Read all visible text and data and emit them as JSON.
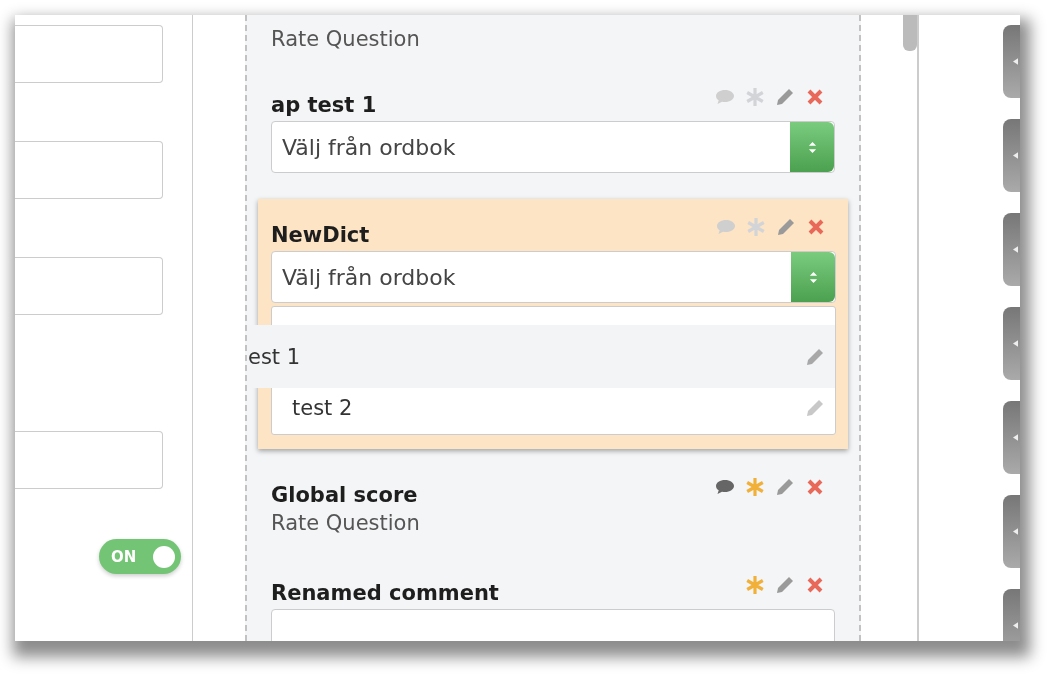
{
  "left_panel": {
    "toggle": {
      "label": "ON",
      "on": true
    }
  },
  "questions": [
    {
      "kind": "rate",
      "subtitle": "Rate Question"
    },
    {
      "kind": "dictionary",
      "title": "ap test 1",
      "comment_icon": true,
      "commented": false,
      "starred": false,
      "highlighted": false,
      "select": {
        "placeholder": "Välj från ordbok"
      }
    },
    {
      "kind": "dictionary",
      "title": "NewDict",
      "comment_icon": true,
      "commented": false,
      "starred": false,
      "highlighted": true,
      "select": {
        "placeholder": "Välj från ordbok"
      },
      "options": [
        {
          "label": "est 1",
          "dragging": true
        },
        {
          "label": "test 2",
          "dragging": false
        }
      ]
    },
    {
      "kind": "rate",
      "title": "Global score",
      "comment_icon": true,
      "commented": true,
      "starred": true,
      "highlighted": false,
      "subtitle": "Rate Question"
    },
    {
      "kind": "text",
      "title": "Renamed comment",
      "comment_icon": false,
      "starred": true,
      "highlighted": false
    }
  ]
}
